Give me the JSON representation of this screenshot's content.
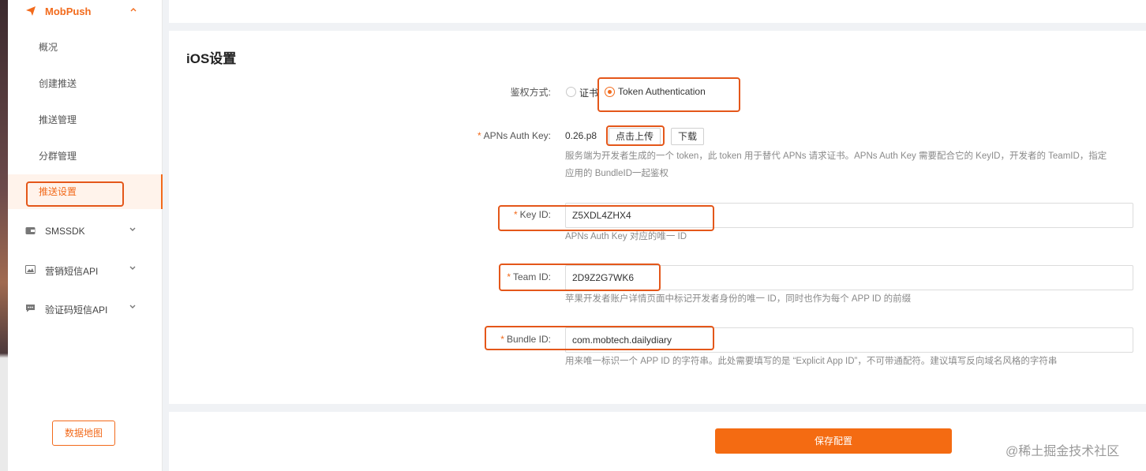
{
  "sidebar": {
    "brand": "MobPush",
    "sub_items": [
      {
        "label": "概况"
      },
      {
        "label": "创建推送"
      },
      {
        "label": "推送管理"
      },
      {
        "label": "分群管理"
      },
      {
        "label": "推送设置"
      }
    ],
    "groups": [
      {
        "label": "SMSSDK",
        "icon": "wallet-icon"
      },
      {
        "label": "营销短信API",
        "icon": "image-icon"
      },
      {
        "label": "验证码短信API",
        "icon": "chat-icon"
      }
    ],
    "map_button": "数据地图"
  },
  "settings": {
    "title": "iOS设置",
    "auth_label": "鉴权方式:",
    "auth_options": [
      "证书",
      "Token Authentication"
    ],
    "auth_selected": "Token Authentication",
    "apns_key_label": "APNs Auth Key:",
    "apns_key_file": "0.26.p8",
    "upload_button": "点击上传",
    "download_button": "下载",
    "apns_hint_line1": "服务端为开发者生成的一个 token，此 token 用于替代 APNs 请求证书。APNs Auth Key 需要配合它的 KeyID，开发者的 TeamID，指定",
    "apns_hint_line2": "应用的 BundleID一起鉴权",
    "key_id_label": "Key ID:",
    "key_id_value": "Z5XDL4ZHX4",
    "key_id_hint": "APNs Auth Key 对应的唯一 ID",
    "team_id_label": "Team ID:",
    "team_id_value": "2D9Z2G7WK6",
    "team_id_hint": "苹果开发者账户详情页面中标记开发者身份的唯一 ID，同时也作为每个 APP ID 的前缀",
    "bundle_id_label": "Bundle ID:",
    "bundle_id_value": "com.mobtech.dailydiary",
    "bundle_id_hint": "用来唯一标识一个 APP ID 的字符串。此处需要填写的是 “Explicit App ID”，不可带通配符。建议填写反向域名风格的字符串"
  },
  "footer": {
    "save_button": "保存配置",
    "watermark": "@稀土掘金技术社区"
  },
  "colors": {
    "accent": "#f26a1b",
    "highlight_box": "#e4571a"
  }
}
